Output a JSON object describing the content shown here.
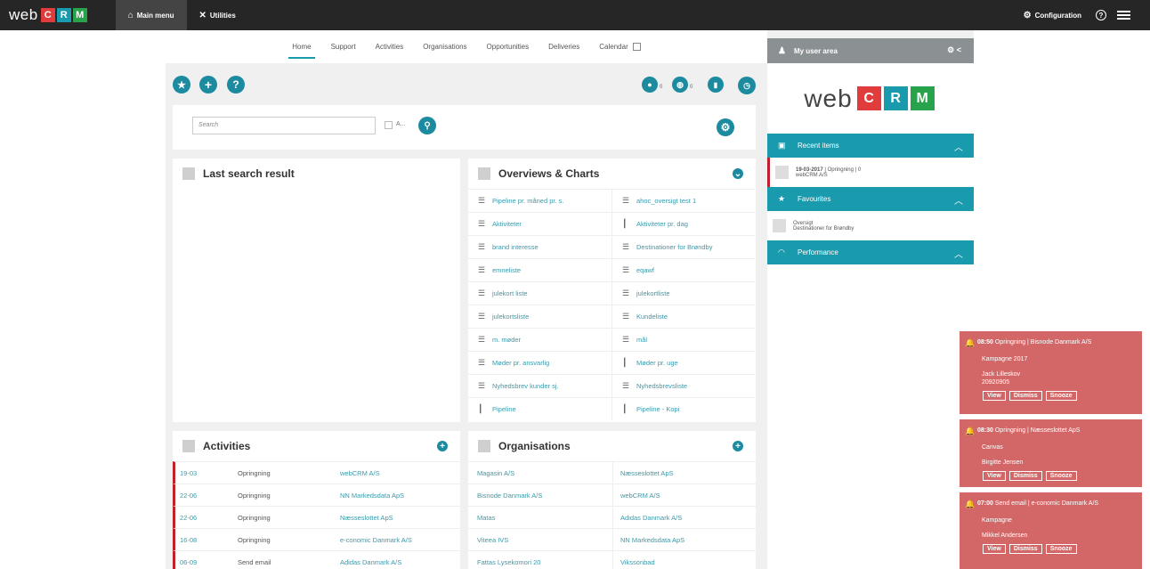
{
  "topbar": {
    "logo_web": "web",
    "logo_letters": [
      "C",
      "R",
      "M"
    ],
    "logo_colors": [
      "#e03c3c",
      "#1a9aad",
      "#28a24b"
    ],
    "main_menu": "Main menu",
    "utilities": "Utilities",
    "configuration": "Configuration",
    "help": "?"
  },
  "subnav": {
    "tabs": [
      "Home",
      "Support",
      "Activities",
      "Organisations",
      "Opportunities",
      "Deliveries",
      "Calendar"
    ]
  },
  "toolbar": {
    "counters": [
      "0",
      "0"
    ]
  },
  "search": {
    "placeholder": "Search",
    "checkbox_label": "A..."
  },
  "last_search": {
    "title": "Last search result"
  },
  "overviews": {
    "title": "Overviews & Charts",
    "items": [
      {
        "label": "Pipeline pr. måned pr. s.",
        "icon": "list"
      },
      {
        "label": "ahoc_oversigt test 1",
        "icon": "list"
      },
      {
        "label": "Aktiviteter",
        "icon": "list"
      },
      {
        "label": "Aktiviteter pr. dag",
        "icon": "chart"
      },
      {
        "label": "brand interesse",
        "icon": "list"
      },
      {
        "label": "Destinationer for Brøndby",
        "icon": "list"
      },
      {
        "label": "emneliste",
        "icon": "list"
      },
      {
        "label": "eqawf",
        "icon": "list"
      },
      {
        "label": "julekort liste",
        "icon": "list"
      },
      {
        "label": "julekortliste",
        "icon": "list"
      },
      {
        "label": "julekortsliste",
        "icon": "list"
      },
      {
        "label": "Kundeliste",
        "icon": "list"
      },
      {
        "label": "m. møder",
        "icon": "list"
      },
      {
        "label": "mål",
        "icon": "list"
      },
      {
        "label": "Møder pr. ansvarlig",
        "icon": "list"
      },
      {
        "label": "Møder pr. uge",
        "icon": "chart"
      },
      {
        "label": "Nyhedsbrev kunder sj.",
        "icon": "list"
      },
      {
        "label": "Nyhedsbrevsliste",
        "icon": "list"
      },
      {
        "label": "Pipeline",
        "icon": "chart"
      },
      {
        "label": "Pipeline - Kopi",
        "icon": "chart"
      }
    ]
  },
  "activities": {
    "title": "Activities",
    "rows": [
      {
        "date": "19-03",
        "type": "Opringning",
        "org": "webCRM A/S"
      },
      {
        "date": "22-06",
        "type": "Opringning",
        "org": "NN Markedsdata ApS"
      },
      {
        "date": "22-06",
        "type": "Opringning",
        "org": "Næsseslottet ApS"
      },
      {
        "date": "16-08",
        "type": "Opringning",
        "org": "e-conomic Danmark A/S"
      },
      {
        "date": "06-09",
        "type": "Send email",
        "org": "Adidas Danmark A/S"
      }
    ]
  },
  "organisations": {
    "title": "Organisations",
    "rows": [
      [
        "Magasin A/S",
        "Næsseslottet ApS"
      ],
      [
        "Bisnode Danmark A/S",
        "webCRM A/S"
      ],
      [
        "Matas",
        "Adidas Danmark A/S"
      ],
      [
        "Viteea IVS",
        "NN Markedsdata ApS"
      ],
      [
        "Fattas Lysekomori 20",
        "Vikssonbad"
      ]
    ]
  },
  "user_area": {
    "title": "My user area",
    "recent_title": "Recent items",
    "recent_item_line1_date": "19-03-2017",
    "recent_item_line1_rest": "| Opringning | 0",
    "recent_item_line2": "webCRM A/S",
    "favourites_title": "Favourites",
    "fav_line1": "Oversigt",
    "fav_line2": "Destinationer for Brøndby",
    "performance_title": "Performance"
  },
  "reminders": [
    {
      "head_time": "08:50",
      "head_text": "Opringning | Bisnode Danmark A/S",
      "campaign": "Kampagne 2017",
      "person": "Jack Lilleskov",
      "phone": "20920905",
      "buttons": [
        "View",
        "Dismiss",
        "Snooze"
      ]
    },
    {
      "head_time": "08:30",
      "head_text": "Opringning | Næsseslottet ApS",
      "campaign": "Canvas",
      "person": "Birgitte Jensen",
      "phone": "",
      "buttons": [
        "View",
        "Dismiss",
        "Snooze"
      ]
    },
    {
      "head_time": "07:00",
      "head_text": "Send email | e-conomic Danmark A/S",
      "campaign": "Kampagne",
      "person": "Mikkel Andersen",
      "phone": "",
      "buttons": [
        "View",
        "Dismiss",
        "Snooze"
      ]
    }
  ]
}
